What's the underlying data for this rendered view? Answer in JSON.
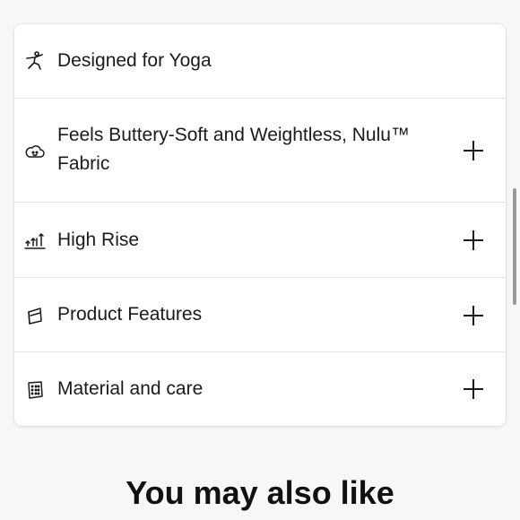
{
  "accordion": {
    "items": [
      {
        "label": "Designed for Yoga",
        "icon": "yoga-pose-icon",
        "expandable": false
      },
      {
        "label_line1": "Feels Buttery-Soft and Weightless, Nulu™",
        "label_line2": "Fabric",
        "icon": "cloud-icon",
        "expandable": true
      },
      {
        "label": "High Rise",
        "icon": "high-rise-icon",
        "expandable": true
      },
      {
        "label": "Product Features",
        "icon": "product-features-icon",
        "expandable": true
      },
      {
        "label": "Material and care",
        "icon": "fabric-swatch-icon",
        "expandable": true
      }
    ]
  },
  "recommendations": {
    "heading": "You may also like"
  }
}
